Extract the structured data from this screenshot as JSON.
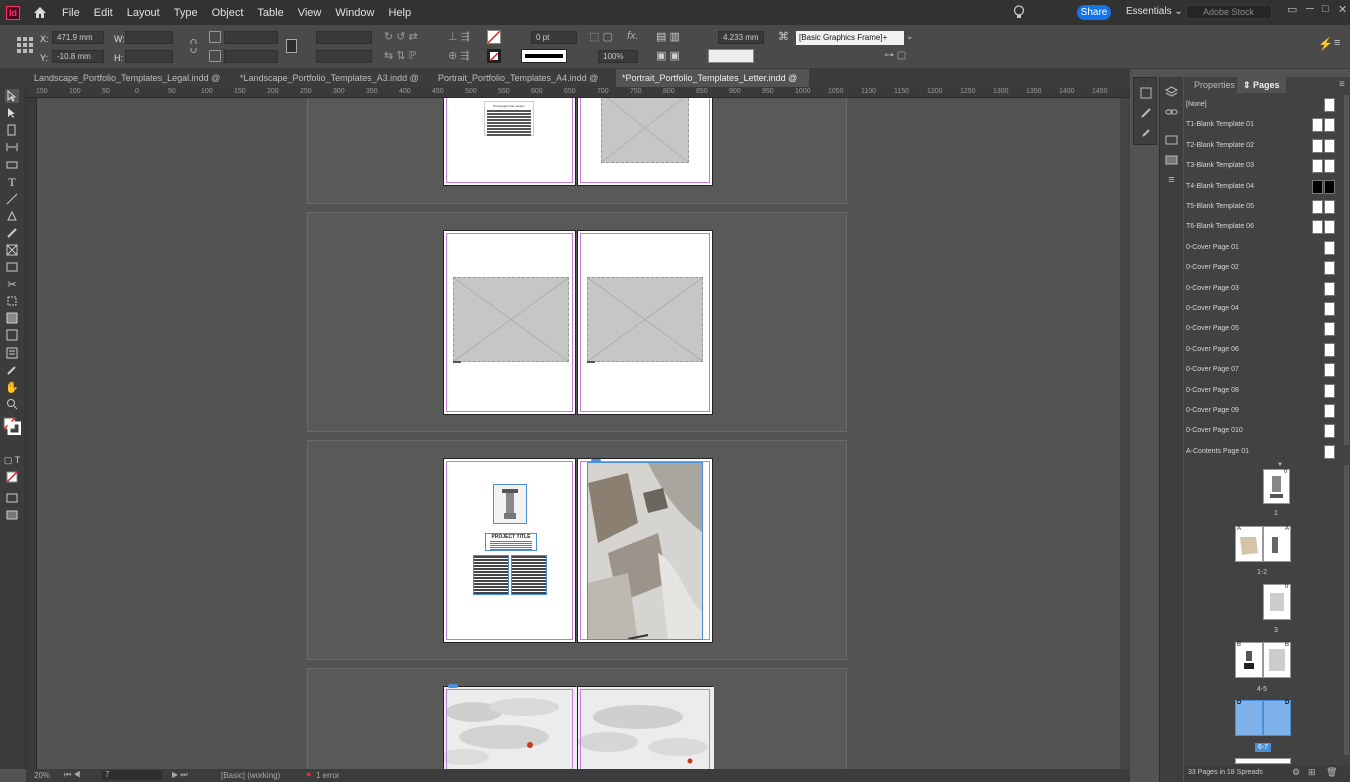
{
  "app": {
    "logo": "Id"
  },
  "menu": [
    "File",
    "Edit",
    "Layout",
    "Type",
    "Object",
    "Table",
    "View",
    "Window",
    "Help"
  ],
  "topbar": {
    "share": "Share",
    "workspace": "Essentials",
    "search_placeholder": "Adobe Stock",
    "window_controls": [
      "▭",
      "─",
      "□",
      "✕"
    ]
  },
  "control": {
    "x_label": "X:",
    "x_value": "471.9 mm",
    "y_label": "Y:",
    "y_value": "-10.8 mm",
    "w_label": "W:",
    "h_label": "H:",
    "stroke_weight": "0 pt",
    "opacity": "100%",
    "dimension": "4.233 mm",
    "object_style": "[Basic Graphics Frame]+",
    "fx_label": "fx."
  },
  "tabs": [
    {
      "label": "Landscape_Portfolio_Templates_Legal.indd @ 50%",
      "close": "✕",
      "active": false
    },
    {
      "label": "*Landscape_Portfolio_Templates_A3.indd @ 50%",
      "close": "✕",
      "active": false
    },
    {
      "label": "Portrait_Portfolio_Templates_A4.indd @ 50%",
      "close": "✕",
      "active": false
    },
    {
      "label": "*Portrait_Portfolio_Templates_Letter.indd @ 25%",
      "close": "✕",
      "active": true
    }
  ],
  "ruler_ticks": [
    "150",
    "100",
    "50",
    "0",
    "50",
    "100",
    "150",
    "200",
    "250",
    "300",
    "350",
    "400",
    "450",
    "500",
    "550",
    "600",
    "650",
    "700",
    "750",
    "800",
    "850",
    "900",
    "950",
    "1000",
    "1050",
    "1100",
    "1150",
    "1200",
    "1250",
    "1300",
    "1350",
    "1400",
    "1450"
  ],
  "canvas": {
    "placeholder_text": "Photograph title caption",
    "project_title": "PROJECT TITLE"
  },
  "status": {
    "zoom": "20%",
    "page": "7",
    "style": "[Basic] (working)",
    "errors": "1 error"
  },
  "panel": {
    "tabs": [
      "Properties",
      "Pages"
    ],
    "masters": [
      {
        "name": "[None]",
        "dark": false
      },
      {
        "name": "T1-Blank Template 01",
        "dark": false
      },
      {
        "name": "T2-Blank Template 02",
        "dark": false
      },
      {
        "name": "T3-Blank Template 03",
        "dark": false
      },
      {
        "name": "T4-Blank Template 04",
        "dark": true
      },
      {
        "name": "T5-Blank Template 05",
        "dark": false
      },
      {
        "name": "T6-Blank Template 06",
        "dark": false
      },
      {
        "name": "0-Cover Page 01",
        "dark": false
      },
      {
        "name": "0-Cover Page 02",
        "dark": false
      },
      {
        "name": "0-Cover Page 03",
        "dark": false
      },
      {
        "name": "0-Cover Page 04",
        "dark": false
      },
      {
        "name": "0-Cover Page 05",
        "dark": false
      },
      {
        "name": "0-Cover Page 06",
        "dark": false
      },
      {
        "name": "0-Cover Page 07",
        "dark": false
      },
      {
        "name": "0-Cover Page 08",
        "dark": false
      },
      {
        "name": "0-Cover Page 09",
        "dark": false
      },
      {
        "name": "0-Cover Page 010",
        "dark": false
      },
      {
        "name": "A-Contents Page 01",
        "dark": false
      }
    ],
    "page_labels": [
      "1",
      "1-2",
      "3",
      "4-5",
      "6-7"
    ],
    "thumb_letters": {
      "p1": "0",
      "p12_left": "A",
      "p12_right": "A",
      "p3": "0",
      "p45_left": "B",
      "p45_right": "B",
      "p67_left": "D",
      "p67_right": "D"
    },
    "footer": "33 Pages in 18 Spreads",
    "accent": "#4a90d9"
  }
}
